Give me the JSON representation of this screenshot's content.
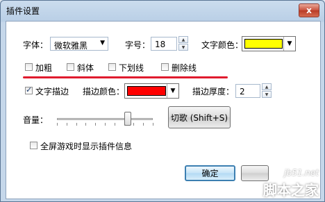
{
  "window": {
    "title": "插件设置",
    "close_glyph": "x"
  },
  "font": {
    "label": "字体：",
    "value": "微软雅黑"
  },
  "size": {
    "label": "字号：",
    "value": "18"
  },
  "text_color": {
    "label": "文字颜色：",
    "color": "#ffff00"
  },
  "styles": {
    "bold": "加粗",
    "italic": "斜体",
    "underline": "下划线",
    "strike": "删除线"
  },
  "outline": {
    "label": "文字描边",
    "color_label": "描边颜色：",
    "color": "#ff0000",
    "thickness_label": "描边厚度：",
    "thickness": "2"
  },
  "volume": {
    "label": "音量：",
    "level_percent": 74
  },
  "switch_song_button": "切歌 (Shift+S)",
  "fullscreen_info": "全屏游戏时显示插件信息",
  "ok_button": "确定",
  "watermark": {
    "url": "jb51.net",
    "text": "脚本之家"
  },
  "colors": {
    "highlight_line": "#e01b2e"
  }
}
